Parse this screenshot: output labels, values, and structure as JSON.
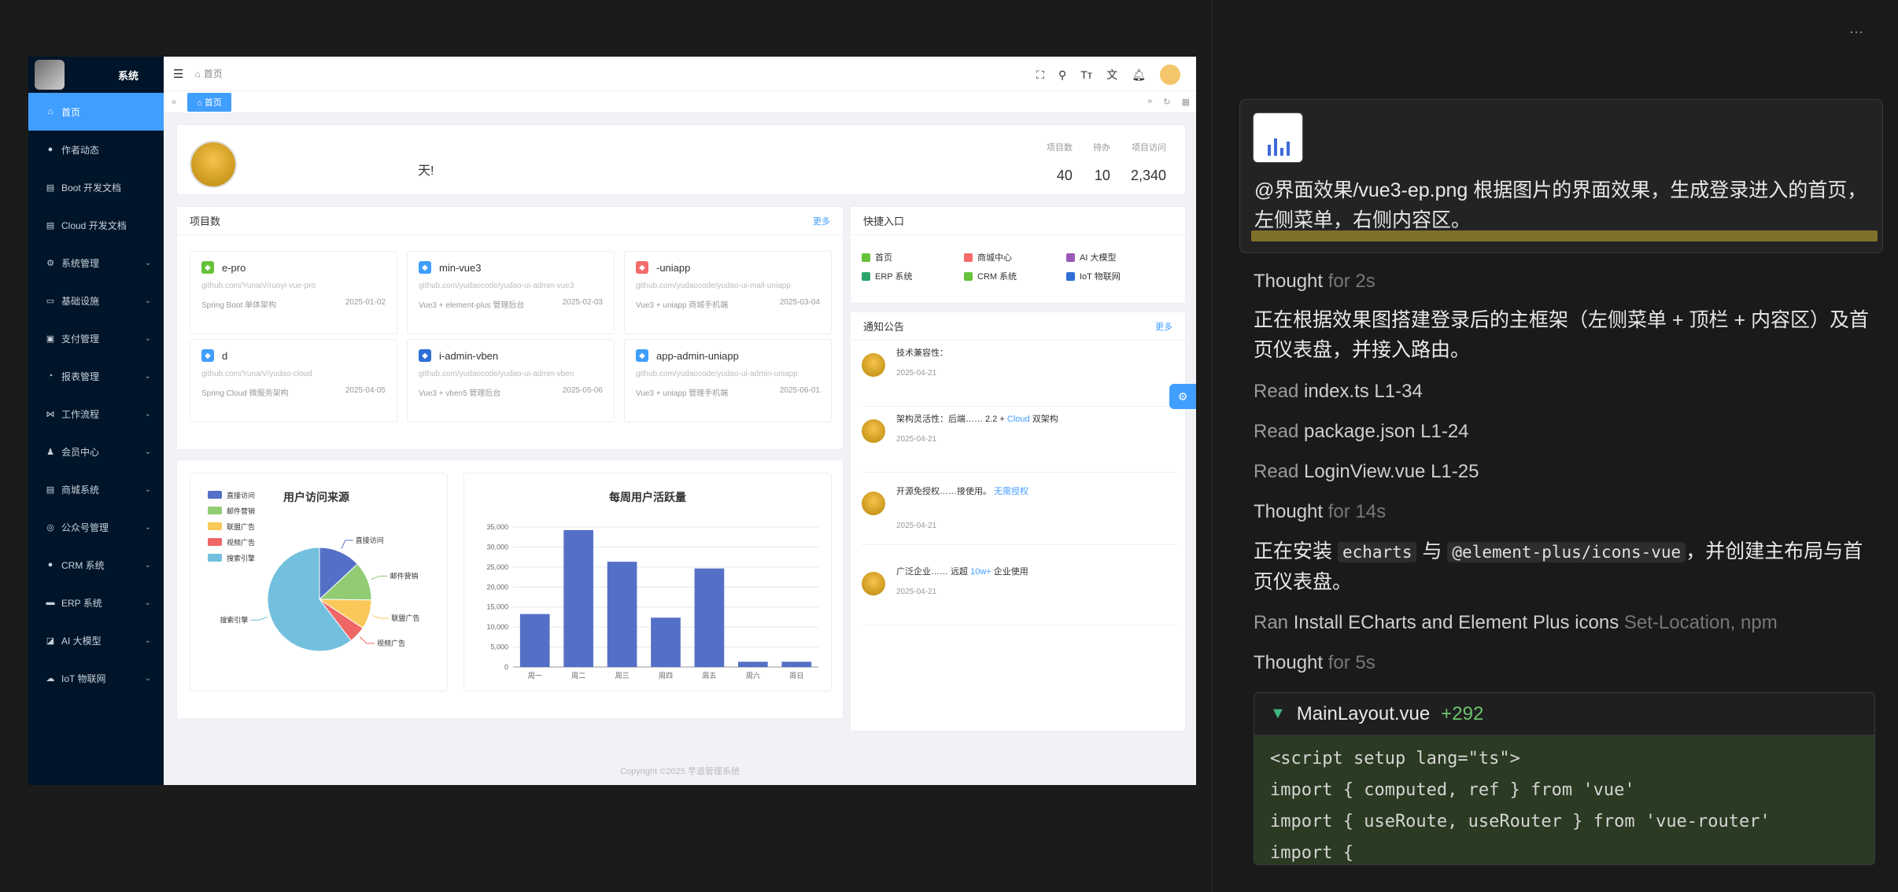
{
  "app": {
    "sidebar": {
      "brand": "系统",
      "items": [
        {
          "label": "首页",
          "icon": "home-icon",
          "active": true
        },
        {
          "label": "作者动态",
          "icon": "user-icon"
        },
        {
          "label": "Boot 开发文档",
          "icon": "doc-icon"
        },
        {
          "label": "Cloud 开发文档",
          "icon": "doc-icon"
        },
        {
          "label": "系统管理",
          "icon": "gear-icon",
          "expandable": true
        },
        {
          "label": "基础设施",
          "icon": "monitor-icon",
          "expandable": true
        },
        {
          "label": "支付管理",
          "icon": "pay-icon",
          "expandable": true
        },
        {
          "label": "报表管理",
          "icon": "chart-icon",
          "expandable": true
        },
        {
          "label": "工作流程",
          "icon": "flow-icon",
          "expandable": true
        },
        {
          "label": "会员中心",
          "icon": "member-icon",
          "expandable": true
        },
        {
          "label": "商城系统",
          "icon": "shop-icon",
          "expandable": true
        },
        {
          "label": "公众号管理",
          "icon": "wechat-icon",
          "expandable": true
        },
        {
          "label": "CRM 系统",
          "icon": "crm-icon",
          "expandable": true
        },
        {
          "label": "ERP 系统",
          "icon": "erp-icon",
          "expandable": true
        },
        {
          "label": "AI 大模型",
          "icon": "ai-icon",
          "expandable": true
        },
        {
          "label": "IoT 物联网",
          "icon": "iot-icon",
          "expandable": true
        }
      ]
    },
    "topbar": {
      "breadcrumb": "首页"
    },
    "tabs": {
      "active": "首页"
    },
    "welcome": {
      "greeting": "天!",
      "stats": [
        {
          "label": "项目数",
          "value": "40"
        },
        {
          "label": "待办",
          "value": "10"
        },
        {
          "label": "项目访问",
          "value": "2,340"
        }
      ]
    },
    "projects": {
      "title": "项目数",
      "more": "更多",
      "items": [
        {
          "name": "e-pro",
          "url": "github.com/YunaiV/ruoyi-vue-pro",
          "desc": "Spring Boot 单体架构",
          "date": "2025-01-02",
          "color": "#67c23a"
        },
        {
          "name": "min-vue3",
          "url": "github.com/yudaocode/yudao-ui-admin-vue3",
          "desc": "Vue3 + element-plus 管理后台",
          "date": "2025-02-03",
          "color": "#409eff"
        },
        {
          "name": "-uniapp",
          "url": "github.com/yudaocode/yudao-ui-mall-uniapp",
          "desc": "Vue3 + uniapp 商城手机端",
          "date": "2025-03-04",
          "color": "#f56c6c"
        },
        {
          "name": "d",
          "url": "github.com/YunaiV/yudao-cloud",
          "desc": "Spring Cloud 微服务架构",
          "date": "2025-04-05",
          "color": "#409eff"
        },
        {
          "name": "i-admin-vben",
          "url": "github.com/yudaocode/yudao-ui-admin-vben",
          "desc": "Vue3 + vben5 管理后台",
          "date": "2025-05-06",
          "color": "#2f6fd6"
        },
        {
          "name": "app-admin-uniapp",
          "url": "github.com/yudaocode/yudao-ui-admin-uniapp",
          "desc": "Vue3 + uniapp 管理手机端",
          "date": "2025-06-01",
          "color": "#409eff"
        }
      ]
    },
    "quick": {
      "title": "快捷入口",
      "items": [
        {
          "label": "首页",
          "color": "#67c23a"
        },
        {
          "label": "商城中心",
          "color": "#f56c6c"
        },
        {
          "label": "AI 大模型",
          "color": "#9b59b6"
        },
        {
          "label": "ERP 系统",
          "color": "#2ea66b"
        },
        {
          "label": "CRM 系统",
          "color": "#67c23a"
        },
        {
          "label": "IoT 物联网",
          "color": "#2f6fd6"
        }
      ]
    },
    "notice": {
      "title": "通知公告",
      "more": "更多",
      "items": [
        {
          "text": "技术兼容性：",
          "link": "",
          "date": "2025-04-21"
        },
        {
          "text": "架构灵活性：后端…… 2.2 +",
          "link": "Cloud",
          "tail": "双架构",
          "date": "2025-04-21"
        },
        {
          "text": "开源免授权……接使用。",
          "link": "无需授权",
          "date": "2025-04-21"
        },
        {
          "text": "广泛企业…… 远超",
          "link": "10w+",
          "tail": "企业使用",
          "date": "2025-04-21"
        }
      ]
    },
    "footer": "Copyright ©2025 芋道管理系统"
  },
  "chart_data": [
    {
      "type": "pie",
      "title": "用户访问来源",
      "categories": [
        "直接访问",
        "邮件营销",
        "联盟广告",
        "视频广告",
        "搜索引擎"
      ],
      "values": [
        335,
        310,
        234,
        135,
        1548
      ],
      "colors": [
        "#5470c6",
        "#91cc75",
        "#fac858",
        "#ee6666",
        "#73c0de"
      ],
      "legend": "top-left"
    },
    {
      "type": "bar",
      "title": "每周用户活跃量",
      "categories": [
        "周一",
        "周二",
        "周三",
        "周四",
        "周五",
        "周六",
        "周日"
      ],
      "values": [
        13253,
        34235,
        26321,
        12340,
        24643,
        1322,
        1324
      ],
      "ylim": [
        0,
        35000
      ],
      "yticks": [
        "0",
        "5,000",
        "10,000",
        "15,000",
        "20,000",
        "25,000",
        "30,000",
        "35,000"
      ],
      "color": "#5470c6",
      "grid": true
    }
  ],
  "chat": {
    "menu": "···",
    "prompt": "@界面效果/vue3-ep.png 根据图片的界面效果，生成登录进入的首页，左侧菜单，右侧内容区。",
    "thought1": {
      "label": "Thought",
      "time": "for 2s"
    },
    "para1": "正在根据效果图搭建登录后的主框架（左侧菜单 + 顶栏 + 内容区）及首页仪表盘，并接入路由。",
    "reads": [
      {
        "verb": "Read",
        "file": "index.ts L1-34"
      },
      {
        "verb": "Read",
        "file": "package.json L1-24"
      },
      {
        "verb": "Read",
        "file": "LoginView.vue L1-25"
      }
    ],
    "thought2": {
      "label": "Thought",
      "time": "for 14s"
    },
    "para2": {
      "pre": "正在安装",
      "c1": "echarts",
      "mid": "与",
      "c2": "@element-plus/icons-vue",
      "post": "，并创建主布局与首页仪表盘。"
    },
    "ran": {
      "verb": "Ran",
      "text": "Install ECharts and Element Plus icons",
      "dim": "Set-Location, npm"
    },
    "thought3": {
      "label": "Thought",
      "time": "for 5s"
    },
    "code": {
      "file": "MainLayout.vue",
      "added": "+292",
      "lines": [
        "<script setup lang=\"ts\">",
        "import { computed, ref } from 'vue'",
        "import { useRoute, useRouter } from 'vue-router'",
        "import {"
      ]
    }
  }
}
